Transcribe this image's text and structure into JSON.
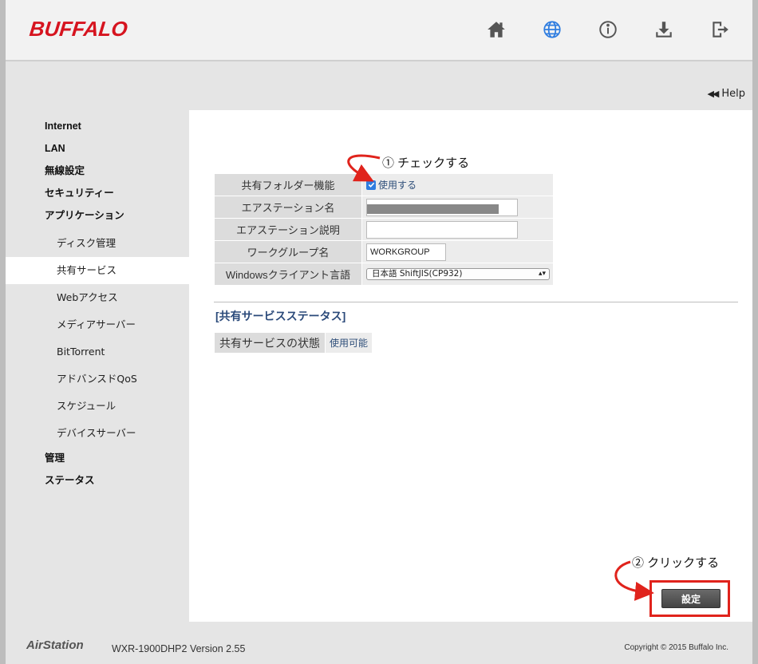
{
  "header": {
    "logo": "BUFFALO",
    "icons": [
      "home-icon",
      "globe-icon",
      "info-icon",
      "download-icon",
      "logout-icon"
    ],
    "brand_color": "#d6141f",
    "active_icon_color": "#2f7de0"
  },
  "help": {
    "label": "Help"
  },
  "sidebar": {
    "items": [
      {
        "label": "Internet",
        "level": 1
      },
      {
        "label": "LAN",
        "level": 1
      },
      {
        "label": "無線設定",
        "level": 1
      },
      {
        "label": "セキュリティー",
        "level": 1
      },
      {
        "label": "アプリケーション",
        "level": 1
      },
      {
        "label": "ディスク管理",
        "level": 2
      },
      {
        "label": "共有サービス",
        "level": 2,
        "active": true
      },
      {
        "label": "Webアクセス",
        "level": 2
      },
      {
        "label": "メディアサーバー",
        "level": 2
      },
      {
        "label": "BitTorrent",
        "level": 2
      },
      {
        "label": "アドバンスドQoS",
        "level": 2
      },
      {
        "label": "スケジュール",
        "level": 2
      },
      {
        "label": "デバイスサーバー",
        "level": 2
      },
      {
        "label": "管理",
        "level": 1
      },
      {
        "label": "ステータス",
        "level": 1
      }
    ]
  },
  "annotations": {
    "step1": "① チェックする",
    "step2": "② クリックする",
    "arrow_color": "#e0231c"
  },
  "form": {
    "shared_folder": {
      "label": "共有フォルダー機能",
      "checkbox_label": "使用する",
      "checked": true
    },
    "station_name": {
      "label": "エアステーション名",
      "value": ""
    },
    "station_desc": {
      "label": "エアステーション説明",
      "value": ""
    },
    "workgroup": {
      "label": "ワークグループ名",
      "value": "WORKGROUP"
    },
    "client_lang": {
      "label": "Windowsクライアント言語",
      "selected": "日本語 ShiftJIS(CP932)"
    }
  },
  "status": {
    "title": "[共有サービスステータス]",
    "label": "共有サービスの状態",
    "value": "使用可能"
  },
  "actions": {
    "set_label": "設定"
  },
  "footer": {
    "product": "AirStation",
    "model": "WXR-1900DHP2   Version 2.55",
    "copyright": "Copyright © 2015 Buffalo Inc."
  }
}
